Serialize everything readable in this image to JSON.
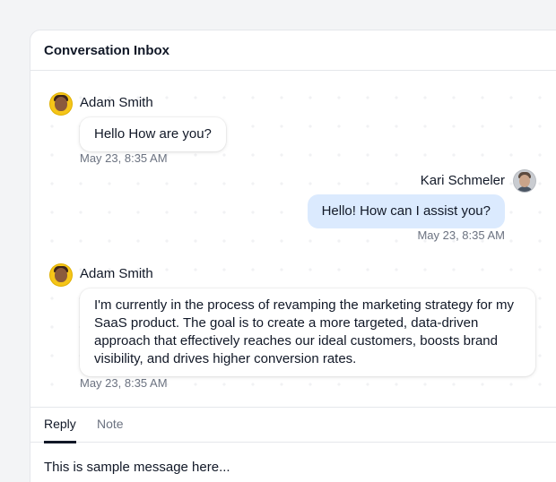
{
  "inbox": {
    "title": "Conversation Inbox"
  },
  "messages": [
    {
      "sender": "Adam Smith",
      "avatar": "adam-smith-avatar",
      "direction": "incoming",
      "text": "Hello How are you?",
      "time": "May 23, 8:35 AM"
    },
    {
      "sender": "Kari Schmeler",
      "avatar": "kari-schmeler-avatar",
      "direction": "outgoing",
      "text": "Hello! How can I assist you?",
      "time": "May 23, 8:35 AM"
    },
    {
      "sender": "Adam Smith",
      "avatar": "adam-smith-avatar",
      "direction": "incoming",
      "text": "I'm currently in the process of revamping the marketing strategy for my SaaS product. The goal is to create a more targeted, data-driven approach that effectively reaches our ideal customers, boosts brand visibility, and drives higher conversion rates.",
      "time": "May 23, 8:35 AM"
    }
  ],
  "composer": {
    "tabs": [
      {
        "label": "Reply",
        "active": true
      },
      {
        "label": "Note",
        "active": false
      }
    ],
    "value": "This is sample message here..."
  },
  "colors": {
    "outgoing_bubble": "#dbeafe",
    "incoming_bubble": "#ffffff",
    "active_tab": "#111827",
    "timestamp": "#6b7280"
  }
}
